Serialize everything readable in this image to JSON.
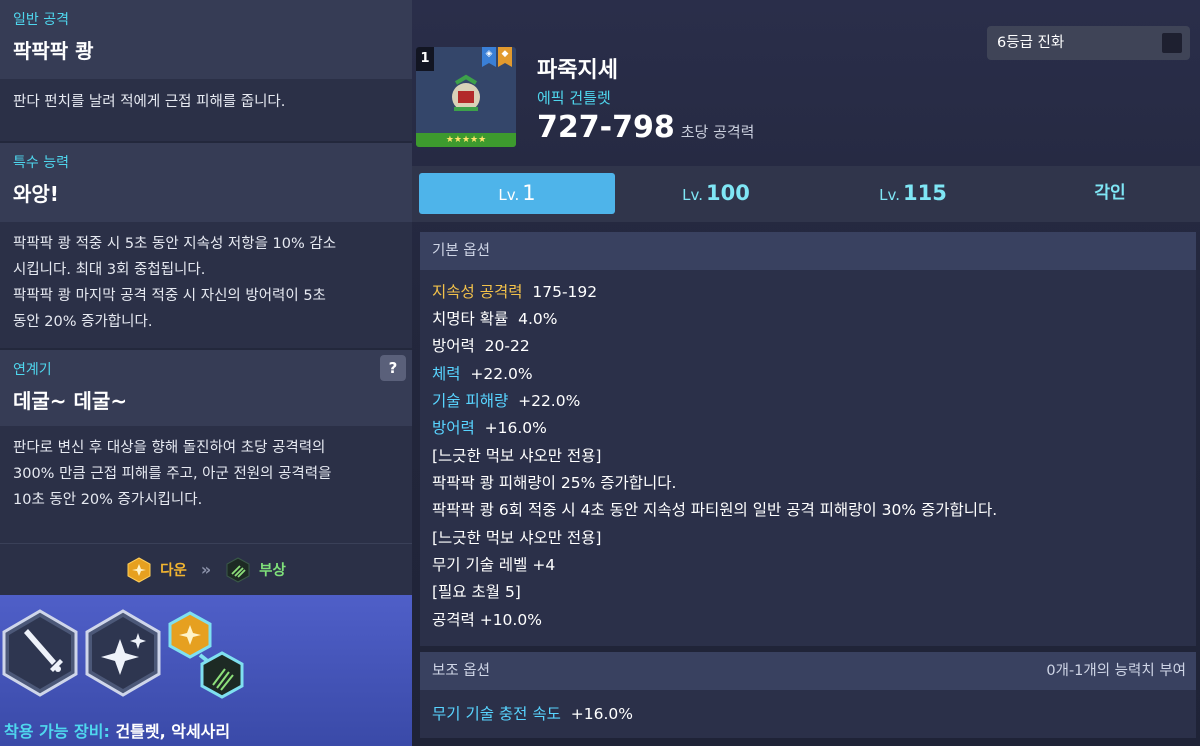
{
  "left": {
    "normal_attack": {
      "category": "일반 공격",
      "title": "팍팍팍 쾅",
      "desc": "판다 펀치를 날려 적에게 근접 피해를 줍니다."
    },
    "special": {
      "category": "특수 능력",
      "title": "와앙!",
      "lines": [
        "팍팍팍 쾅 적중 시 5초 동안 지속성 저항을 10% 감소",
        "시킵니다. 최대 3회 중첩됩니다.",
        "팍팍팍 쾅 마지막 공격 적중 시 자신의 방어력이 5초",
        "동안 20% 증가합니다."
      ]
    },
    "chain": {
      "category": "연계기",
      "title": "데굴~ 데굴~",
      "help": "?",
      "lines": [
        "판다로 변신 후 대상을 향해 돌진하여 초당 공격력의",
        "300% 만큼 근접 피해를 주고, 아군 전원의 공격력을",
        "10초 동안 20% 증가시킵니다."
      ]
    },
    "chain_flow": {
      "from": "다운",
      "arrow": "»",
      "to": "부상"
    },
    "equip": {
      "label": "착용 가능 장비:",
      "value": "건틀렛, 악세사리"
    }
  },
  "item": {
    "grade_badge": "1",
    "stars": "★★★★★",
    "name": "파죽지세",
    "type": "에픽 건틀렛",
    "attack": "727-798",
    "attack_unit": "초당 공격력",
    "evolve_label": "6등급 진화"
  },
  "tabs": [
    {
      "prefix": "Lv.",
      "num": "1"
    },
    {
      "prefix": "Lv.",
      "num": "100"
    },
    {
      "prefix": "Lv.",
      "num": "115"
    },
    {
      "prefix": "",
      "num": "각인"
    }
  ],
  "basic": {
    "header": "기본 옵션",
    "rows": [
      {
        "key": "지속성 공격력",
        "val": "175-192"
      },
      {
        "key": "치명타 확률",
        "val": "4.0%"
      },
      {
        "key": "방어력",
        "val": "20-22"
      },
      {
        "key": "체력",
        "val": "+22.0%"
      },
      {
        "key": "기술 피해량",
        "val": "+22.0%"
      },
      {
        "key": "방어력",
        "val": "+16.0%"
      }
    ],
    "notes": [
      "[느긋한 먹보 샤오만 전용]",
      "팍팍팍 쾅 피해량이 25% 증가합니다.",
      "팍팍팍 쾅 6회 적중 시 4초 동안 지속성 파티원의 일반 공격 피해량이 30% 증가합니다.",
      "[느긋한 먹보 샤오만 전용]",
      "무기 기술 레벨 +4",
      "[필요 초월 5]",
      "공격력 +10.0%"
    ]
  },
  "sub": {
    "header": "보조 옵션",
    "note": "0개-1개의 능력치 부여",
    "row": {
      "key": "무기 기술 충전 속도",
      "val": "+16.0%"
    }
  },
  "colors": {
    "accent_cyan": "#4fd7ee",
    "tab_active": "#4eb4ea",
    "gold": "#f2b530",
    "green": "#7fe07a"
  }
}
